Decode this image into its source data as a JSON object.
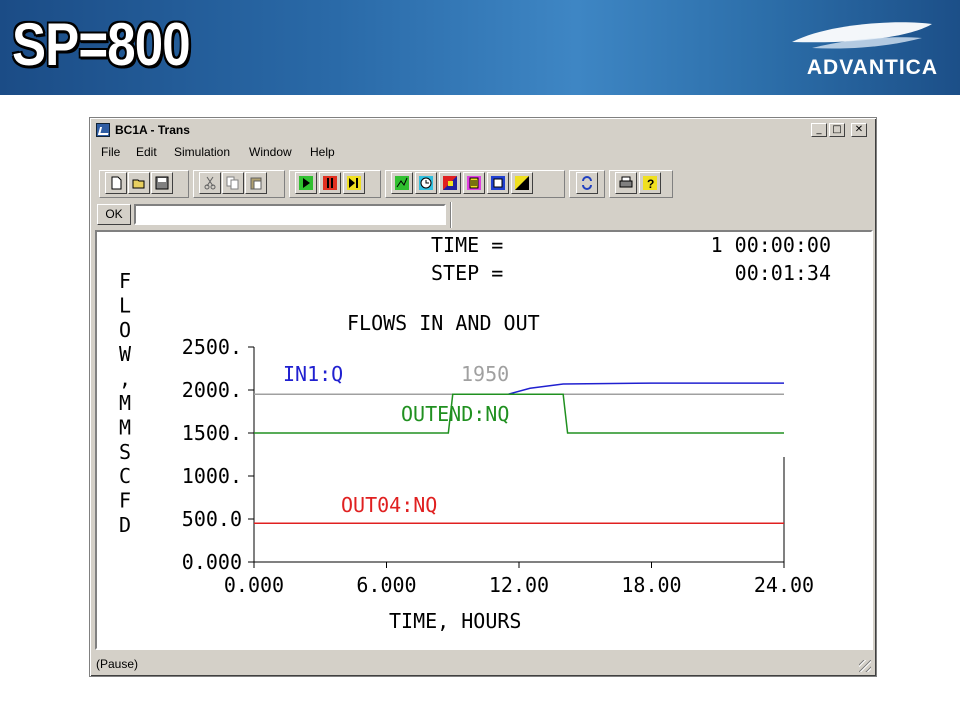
{
  "slide": {
    "title": "SP=800",
    "brand": "ADVANTICA"
  },
  "window": {
    "title": "BC1A - Trans",
    "min_glyph": "_",
    "max_glyph": "□",
    "close_glyph": "✕"
  },
  "menu": [
    "File",
    "Edit",
    "Simulation",
    "Window",
    "Help"
  ],
  "toolbar": {
    "buttons": [
      "new-icon",
      "open-icon",
      "save-icon",
      "cut-icon",
      "copy-icon",
      "paste-icon",
      "run-icon",
      "pause-icon",
      "step-icon",
      "plot-icon",
      "clock-icon",
      "color-icon",
      "list-icon",
      "window-icon",
      "chart-icon",
      "refresh-icon",
      "print-icon",
      "help-icon"
    ]
  },
  "command": {
    "ok_label": "OK",
    "value": ""
  },
  "display": {
    "time_label": "TIME =",
    "time_value": "1 00:00:00",
    "step_label": "STEP =",
    "step_value": "00:01:34",
    "plot_title": "FLOWS IN AND OUT",
    "ylabel": "FLOW, MMSCFD",
    "xlabel": "TIME, HOURS"
  },
  "chart_data": {
    "type": "line",
    "title": "FLOWS IN AND OUT",
    "xlabel": "TIME, HOURS",
    "ylabel": "FLOW, MMSCFD",
    "xlim": [
      0,
      24
    ],
    "ylim": [
      0,
      2500
    ],
    "x_ticks": [
      "0.000",
      "6.000",
      "12.00",
      "18.00",
      "24.00"
    ],
    "y_ticks": [
      "0.000",
      "500.0",
      "1000.",
      "1500.",
      "2000.",
      "2500."
    ],
    "series": [
      {
        "name": "IN1:Q",
        "color": "#2020d0",
        "x": [
          0,
          11.5,
          12.5,
          14,
          18,
          24
        ],
        "y": [
          1950,
          1950,
          2020,
          2070,
          2080,
          2080
        ]
      },
      {
        "name": "1950",
        "color": "#a0a0a0",
        "x": [
          0,
          24
        ],
        "y": [
          1950,
          1950
        ]
      },
      {
        "name": "OUTEND:NQ",
        "color": "#209020",
        "x": [
          0,
          8.8,
          9.0,
          14.0,
          14.2,
          24
        ],
        "y": [
          1500,
          1500,
          1950,
          1950,
          1500,
          1500
        ]
      },
      {
        "name": "OUT04:NQ",
        "color": "#e02020",
        "x": [
          0,
          24
        ],
        "y": [
          450,
          450
        ]
      }
    ]
  },
  "status": {
    "text": "(Pause)"
  }
}
